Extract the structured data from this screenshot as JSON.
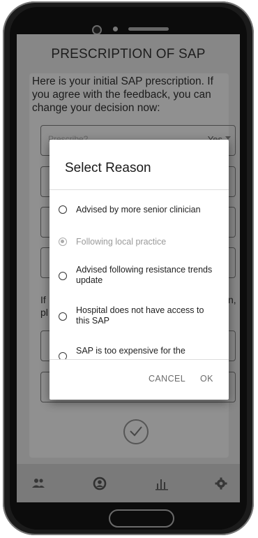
{
  "app": {
    "title": "PRESCRIPTION OF SAP",
    "intro": "Here is your initial SAP prescription. If you agree with the feedback, you can change your decision now:"
  },
  "form": {
    "prescribe_label": "Prescribe?",
    "prescribe_value": "Yes",
    "behind_left": "If",
    "behind_left2": "pl",
    "behind_right": "n,"
  },
  "dialog": {
    "title": "Select Reason",
    "options": [
      {
        "label": "Advised by more senior clinician",
        "selected": false
      },
      {
        "label": "Following local practice",
        "selected": true
      },
      {
        "label": "Advised following resistance trends update",
        "selected": false
      },
      {
        "label": "Hospital does not have access to this SAP",
        "selected": false
      },
      {
        "label": "SAP is too expensive for the",
        "selected": false
      }
    ],
    "cancel_label": "CANCEL",
    "ok_label": "OK"
  },
  "nav": {
    "icons": [
      "group-icon",
      "account-icon",
      "bar-chart-icon",
      "settings-icon"
    ]
  }
}
